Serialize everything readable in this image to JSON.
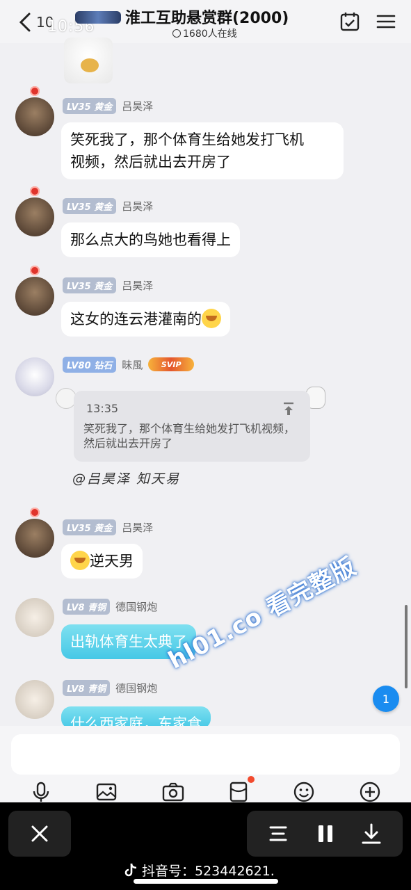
{
  "status_bar": {
    "time": "10:56",
    "back_count": "10"
  },
  "header": {
    "title": "淮工互助悬赏群(2000)",
    "online": "1680人在线"
  },
  "messages": [
    {
      "level": "LV35",
      "rank": "黄金",
      "name": "吕昊泽",
      "text": "笑死我了，那个体育生给她发打飞机视频，然后就出去开房了",
      "line1": "笑死我了，那个体育生给她发打飞机",
      "line2": "视频，然后就出去开房了"
    },
    {
      "level": "LV35",
      "rank": "黄金",
      "name": "吕昊泽",
      "text": "那么点大的鸟她也看得上"
    },
    {
      "level": "LV35",
      "rank": "黄金",
      "name": "吕昊泽",
      "text": "这女的连云港灌南的"
    },
    {
      "level": "LV80",
      "rank": "钻石",
      "name": "昧風",
      "badge": "SVIP",
      "quote_time": "13:35",
      "quote_text": "笑死我了，那个体育生给她发打飞机视频，然后就出去开房了",
      "mention": "@吕昊泽 知天易"
    },
    {
      "level": "LV35",
      "rank": "黄金",
      "name": "吕昊泽",
      "text": "逆天男"
    },
    {
      "level": "LV8",
      "rank": "青铜",
      "name": "德国钢炮",
      "text": "出轨体育生太典了"
    },
    {
      "level": "LV8",
      "rank": "青铜",
      "name": "德国钢炮",
      "text": "什么西家庭，东家食"
    }
  ],
  "watermark": "hl01.co 看完整版",
  "unread_count": "1",
  "toolbar": [
    "mic-icon",
    "image-icon",
    "camera-icon",
    "red-packet-icon",
    "emoji-icon",
    "plus-icon"
  ],
  "footer": {
    "douyin_label": "抖音号：523442621."
  },
  "colors": {
    "accent": "#1a8cf0",
    "cyan_bubble": "#46c8e6",
    "flower": "#e0342c"
  }
}
